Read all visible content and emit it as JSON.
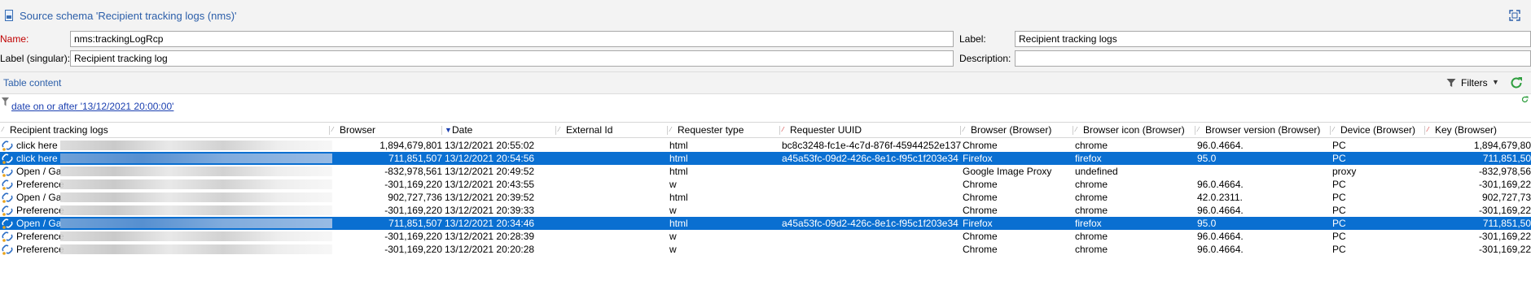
{
  "window": {
    "title": "Source schema 'Recipient tracking logs (nms)'"
  },
  "form": {
    "name_label": "Name:",
    "name_value": "nms:trackingLogRcp",
    "label_label": "Label:",
    "label_value": "Recipient tracking logs",
    "singular_label": "Label (singular):",
    "singular_value": "Recipient tracking log",
    "description_label": "Description:",
    "description_value": ""
  },
  "section": {
    "title": "Table content",
    "filters_label": "Filters"
  },
  "filter": {
    "condition": "date on or after '13/12/2021 20:00:00'"
  },
  "grid": {
    "columns": [
      "Recipient tracking logs",
      "Browser",
      "Date",
      "External Id",
      "Requester type",
      "Requester UUID",
      "Browser (Browser)",
      "Browser icon (Browser)",
      "Browser version (Browser)",
      "Device (Browser)",
      "Key (Browser)"
    ],
    "rows": [
      {
        "log": "click here",
        "browser": "1,894,679,801",
        "date": "13/12/2021 20:55:02",
        "external_id": "",
        "requester_type": "html",
        "uuid": "bc8c3248-fc1e-4c7d-876f-45944252e137",
        "browser_name": "Chrome",
        "icon": "chrome",
        "version": "96.0.4664.",
        "device": "PC",
        "key": "1,894,679,80",
        "selected": false
      },
      {
        "log": "click here",
        "browser": "711,851,507",
        "date": "13/12/2021 20:54:56",
        "external_id": "",
        "requester_type": "html",
        "uuid": "a45a53fc-09d2-426c-8e1c-f95c1f203e34",
        "browser_name": "Firefox",
        "icon": "firefox",
        "version": "95.0",
        "device": "PC",
        "key": "711,851,50",
        "selected": true
      },
      {
        "log": "Open / Ga",
        "browser": "-832,978,561",
        "date": "13/12/2021 20:49:52",
        "external_id": "",
        "requester_type": "html",
        "uuid": "",
        "browser_name": "Google Image Proxy",
        "icon": "undefined",
        "version": "",
        "device": "proxy",
        "key": "-832,978,56",
        "selected": false
      },
      {
        "log": "Preference",
        "browser": "-301,169,220",
        "date": "13/12/2021 20:43:55",
        "external_id": "",
        "requester_type": "w",
        "uuid": "",
        "browser_name": "Chrome",
        "icon": "chrome",
        "version": "96.0.4664.",
        "device": "PC",
        "key": "-301,169,22",
        "selected": false
      },
      {
        "log": "Open / Ga",
        "browser": "902,727,736",
        "date": "13/12/2021 20:39:52",
        "external_id": "",
        "requester_type": "html",
        "uuid": "",
        "browser_name": "Chrome",
        "icon": "chrome",
        "version": "42.0.2311.",
        "device": "PC",
        "key": "902,727,73",
        "selected": false
      },
      {
        "log": "Preference",
        "browser": "-301,169,220",
        "date": "13/12/2021 20:39:33",
        "external_id": "",
        "requester_type": "w",
        "uuid": "",
        "browser_name": "Chrome",
        "icon": "chrome",
        "version": "96.0.4664.",
        "device": "PC",
        "key": "-301,169,22",
        "selected": false
      },
      {
        "log": "Open / Ga",
        "browser": "711,851,507",
        "date": "13/12/2021 20:34:46",
        "external_id": "",
        "requester_type": "html",
        "uuid": "a45a53fc-09d2-426c-8e1c-f95c1f203e34",
        "browser_name": "Firefox",
        "icon": "firefox",
        "version": "95.0",
        "device": "PC",
        "key": "711,851,50",
        "selected": true
      },
      {
        "log": "Preference",
        "browser": "-301,169,220",
        "date": "13/12/2021 20:28:39",
        "external_id": "",
        "requester_type": "w",
        "uuid": "",
        "browser_name": "Chrome",
        "icon": "chrome",
        "version": "96.0.4664.",
        "device": "PC",
        "key": "-301,169,22",
        "selected": false
      },
      {
        "log": "Preference",
        "browser": "-301,169,220",
        "date": "13/12/2021 20:20:28",
        "external_id": "",
        "requester_type": "w",
        "uuid": "",
        "browser_name": "Chrome",
        "icon": "chrome",
        "version": "96.0.4664.",
        "device": "PC",
        "key": "-301,169,22",
        "selected": false
      }
    ]
  },
  "colors": {
    "accent": "#2b5ea9",
    "required_label": "#c00000",
    "selection": "#0a6fd1",
    "refresh_green": "#2e9e3e"
  },
  "icons": {
    "title": "schema-file-icon",
    "expand": "maximize-icon",
    "filters": "funnel-icon",
    "refresh": "refresh-icon",
    "row": "tracking-log-icon"
  }
}
